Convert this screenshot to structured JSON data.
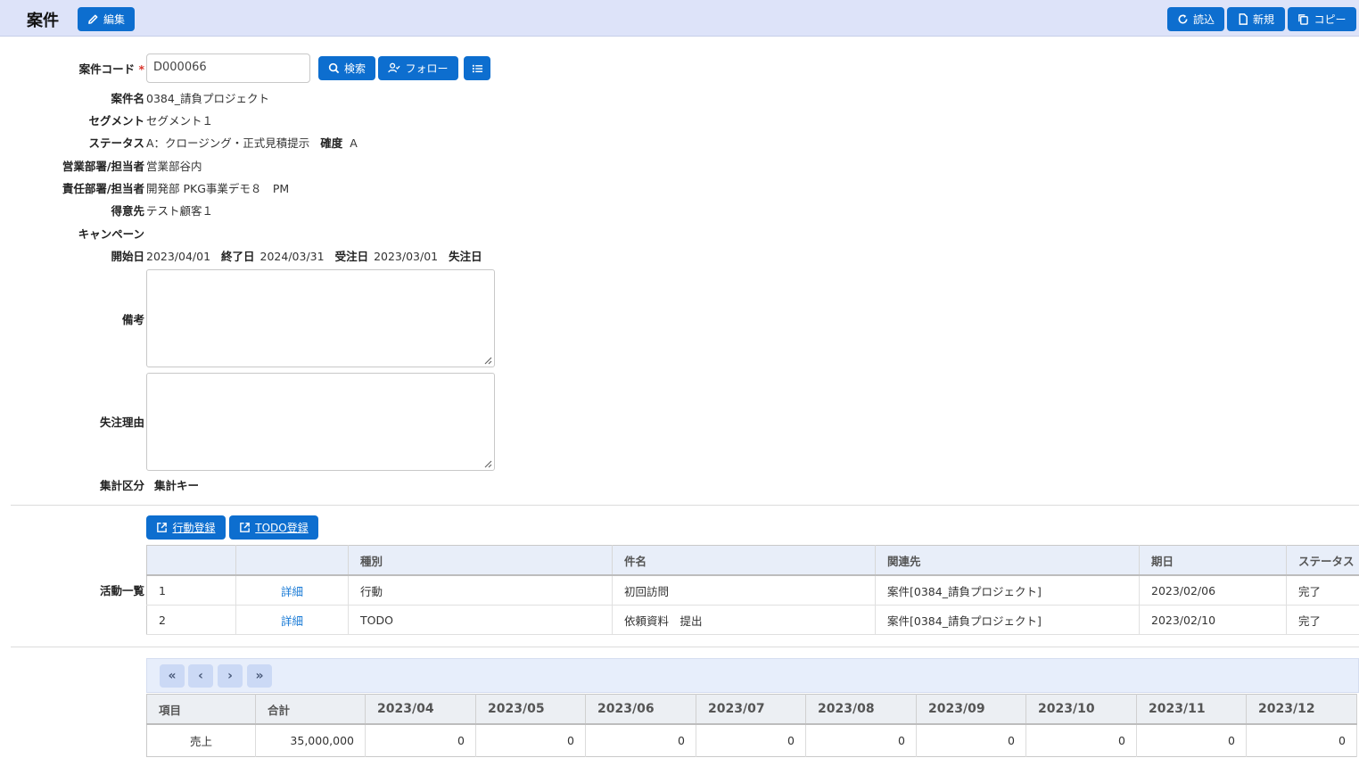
{
  "header": {
    "title": "案件",
    "edit_label": "編集",
    "reload_label": "読込",
    "new_label": "新規",
    "copy_label": "コピー"
  },
  "form": {
    "code_label": "案件コード",
    "required_mark": "*",
    "code_value": "D000066",
    "search_label": "検索",
    "follow_label": "フォロー",
    "name_label": "案件名",
    "name_value": "0384_請負プロジェクト",
    "segment_label": "セグメント",
    "segment_value": "セグメント１",
    "status_label": "ステータス",
    "status_value": "A：クロージング・正式見積提示",
    "certainty_label": "確度",
    "certainty_value": "A",
    "sales_label": "営業部署/担当者",
    "sales_value": "営業部谷内",
    "resp_label": "責任部署/担当者",
    "resp_value": "開発部 PKG事業デモ８　PM",
    "customer_label": "得意先",
    "customer_value": "テスト顧客１",
    "campaign_label": "キャンペーン",
    "start_label": "開始日",
    "start_value": "2023/04/01",
    "end_label": "終了日",
    "end_value": "2024/03/31",
    "order_label": "受注日",
    "order_value": "2023/03/01",
    "lost_label": "失注日",
    "memo_label": "備考",
    "lost_reason_label": "失注理由",
    "agg_label": "集計区分",
    "agg_key_label": "集計キー"
  },
  "activities": {
    "register_action_label": "行動登録",
    "register_todo_label": "TODO登録",
    "section_label": "活動一覧",
    "columns": [
      "",
      "",
      "種別",
      "件名",
      "関連先",
      "期日",
      "ステータス"
    ],
    "rows": [
      {
        "no": "1",
        "link": "詳細",
        "type": "行動",
        "subject": "初回訪問",
        "related": "案件[0384_請負プロジェクト]",
        "due": "2023/02/06",
        "status": "完了"
      },
      {
        "no": "2",
        "link": "詳細",
        "type": "TODO",
        "subject": "依頼資料　提出",
        "related": "案件[0384_請負プロジェクト]",
        "due": "2023/02/10",
        "status": "完了"
      }
    ]
  },
  "pager": {
    "first": "«",
    "prev": "‹",
    "next": "›",
    "last": "»"
  },
  "finance": {
    "columns": [
      "項目",
      "合計",
      "2023/04",
      "2023/05",
      "2023/06",
      "2023/07",
      "2023/08",
      "2023/09",
      "2023/10",
      "2023/11",
      "2023/12"
    ],
    "row": [
      "売上",
      "35,000,000",
      "0",
      "0",
      "0",
      "0",
      "0",
      "0",
      "0",
      "0",
      "0"
    ]
  },
  "colors": {
    "primary": "#0d6ecf",
    "header_bg": "#dde3f9",
    "link": "#1a7bd6"
  }
}
